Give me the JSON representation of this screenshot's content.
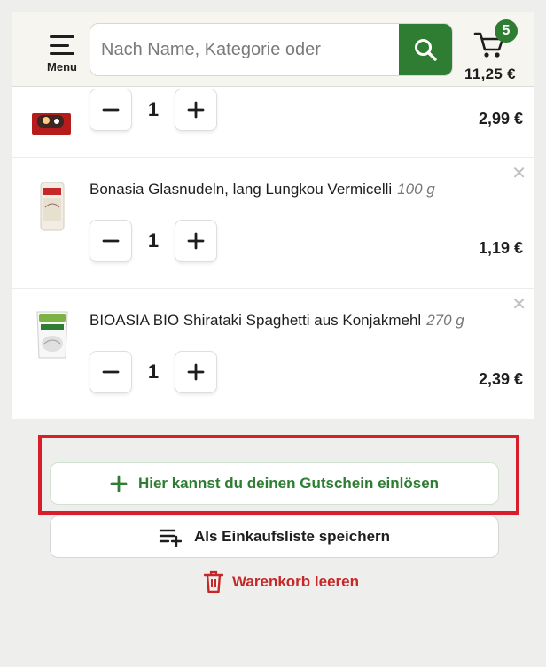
{
  "header": {
    "menu_label": "Menu",
    "search_placeholder": "Nach Name, Kategorie oder",
    "cart": {
      "count": "5",
      "total": "11,25 €"
    }
  },
  "items": [
    {
      "name": "",
      "weight": "",
      "quantity": "1",
      "price": "2,99 €"
    },
    {
      "name": "Bonasia Glasnudeln, lang Lungkou Vermicelli",
      "weight": "100 g",
      "quantity": "1",
      "price": "1,19 €"
    },
    {
      "name": "BIOASIA BIO Shirataki Spaghetti aus Konjakmehl",
      "weight": "270 g",
      "quantity": "1",
      "price": "2,39 €"
    }
  ],
  "actions": {
    "coupon_label": "Hier kannst du deinen Gutschein einlösen",
    "save_list_label": "Als Einkaufsliste speichern",
    "empty_cart_label": "Warenkorb leeren"
  },
  "colors": {
    "brand_green": "#2e7d32",
    "danger_red": "#c62828",
    "highlight_red": "#d81e2a"
  }
}
